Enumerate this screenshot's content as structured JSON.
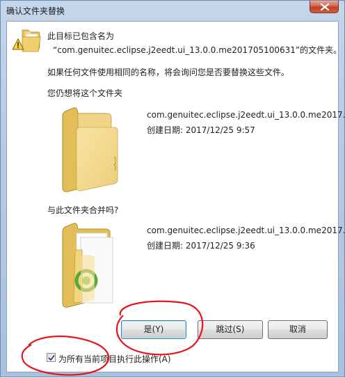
{
  "window": {
    "title": "确认文件夹替换"
  },
  "message": {
    "line1": "此目标已包含名为",
    "line2": "“com.genuitec.eclipse.j2eedt.ui_13.0.0.me201705100631”的文件夹。",
    "line3": "如果任何文件使用相同的名称，将会询问您是否要替换这些文件。",
    "line4": "您仍想将这个文件夹"
  },
  "existing_folder": {
    "name": "com.genuitec.eclipse.j2eedt.ui_13.0.0.me2017...",
    "created": "创建日期: 2017/12/25 9:57"
  },
  "merge_question": "与此文件夹合并吗?",
  "new_folder": {
    "name": "com.genuitec.eclipse.j2eedt.ui_13.0.0.me2017...",
    "created": "创建日期: 2017/12/25 9:36"
  },
  "buttons": {
    "yes": "是(Y)",
    "skip": "跳过(S)",
    "cancel": "取消"
  },
  "checkbox": {
    "label": "为所有当前项目执行此操作(A)",
    "checked": true
  },
  "colors": {
    "annotation": "#e8141c",
    "default_button_border": "#3c7fb1"
  }
}
